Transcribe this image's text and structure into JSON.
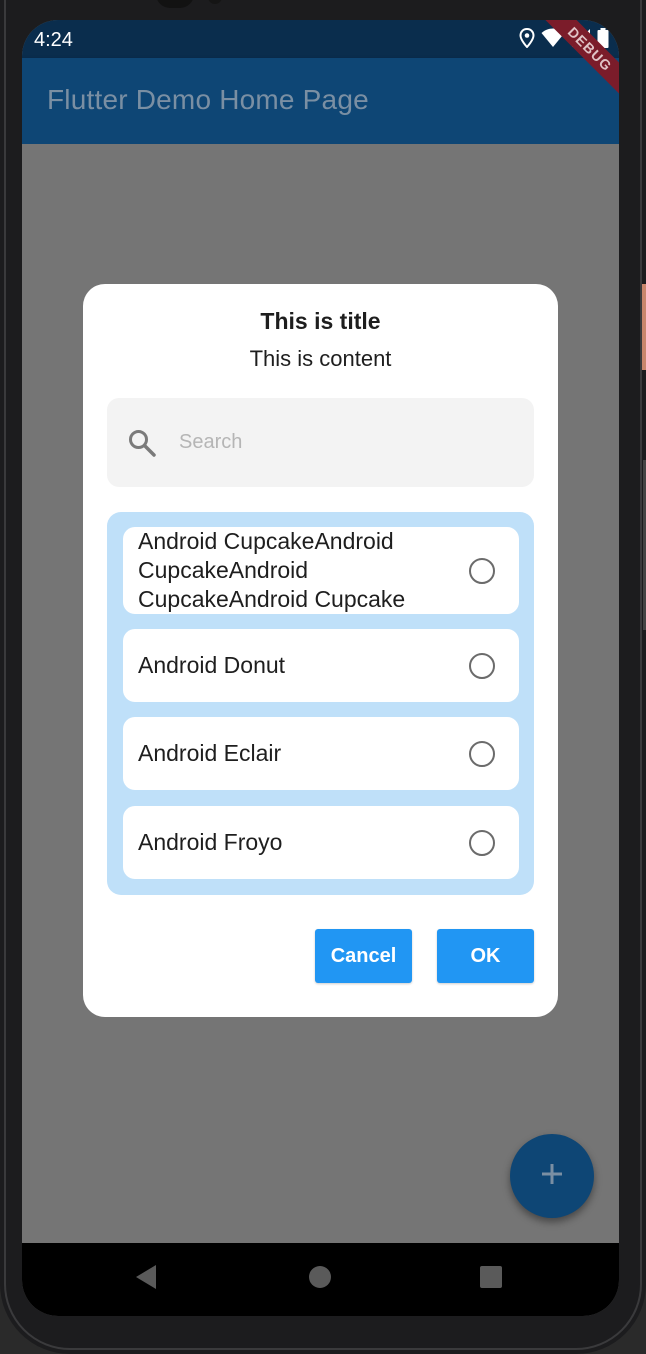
{
  "status_bar": {
    "time": "4:24",
    "icons": [
      "location-icon",
      "wifi-icon",
      "signal-icon",
      "battery-icon"
    ]
  },
  "app_bar": {
    "title": "Flutter Demo Home Page",
    "debug_banner": "DEBUG"
  },
  "dialog": {
    "title": "This is title",
    "content": "This is content",
    "search": {
      "placeholder": "Search",
      "value": ""
    },
    "options": [
      {
        "label": "Android CupcakeAndroid CupcakeAndroid CupcakeAndroid Cupcake",
        "selected": false
      },
      {
        "label": "Android Donut",
        "selected": false
      },
      {
        "label": "Android Eclair",
        "selected": false
      },
      {
        "label": "Android Froyo",
        "selected": false
      }
    ],
    "buttons": {
      "cancel": "Cancel",
      "ok": "OK"
    }
  },
  "fab": {
    "icon": "plus-icon"
  },
  "nav_bar": {
    "icons": [
      "back-icon",
      "home-icon",
      "recents-icon"
    ]
  },
  "colors": {
    "primary": "#2196f3",
    "app_bar": "#0e4675",
    "options_panel": "#bfe0f9",
    "scrim": "#757575"
  }
}
